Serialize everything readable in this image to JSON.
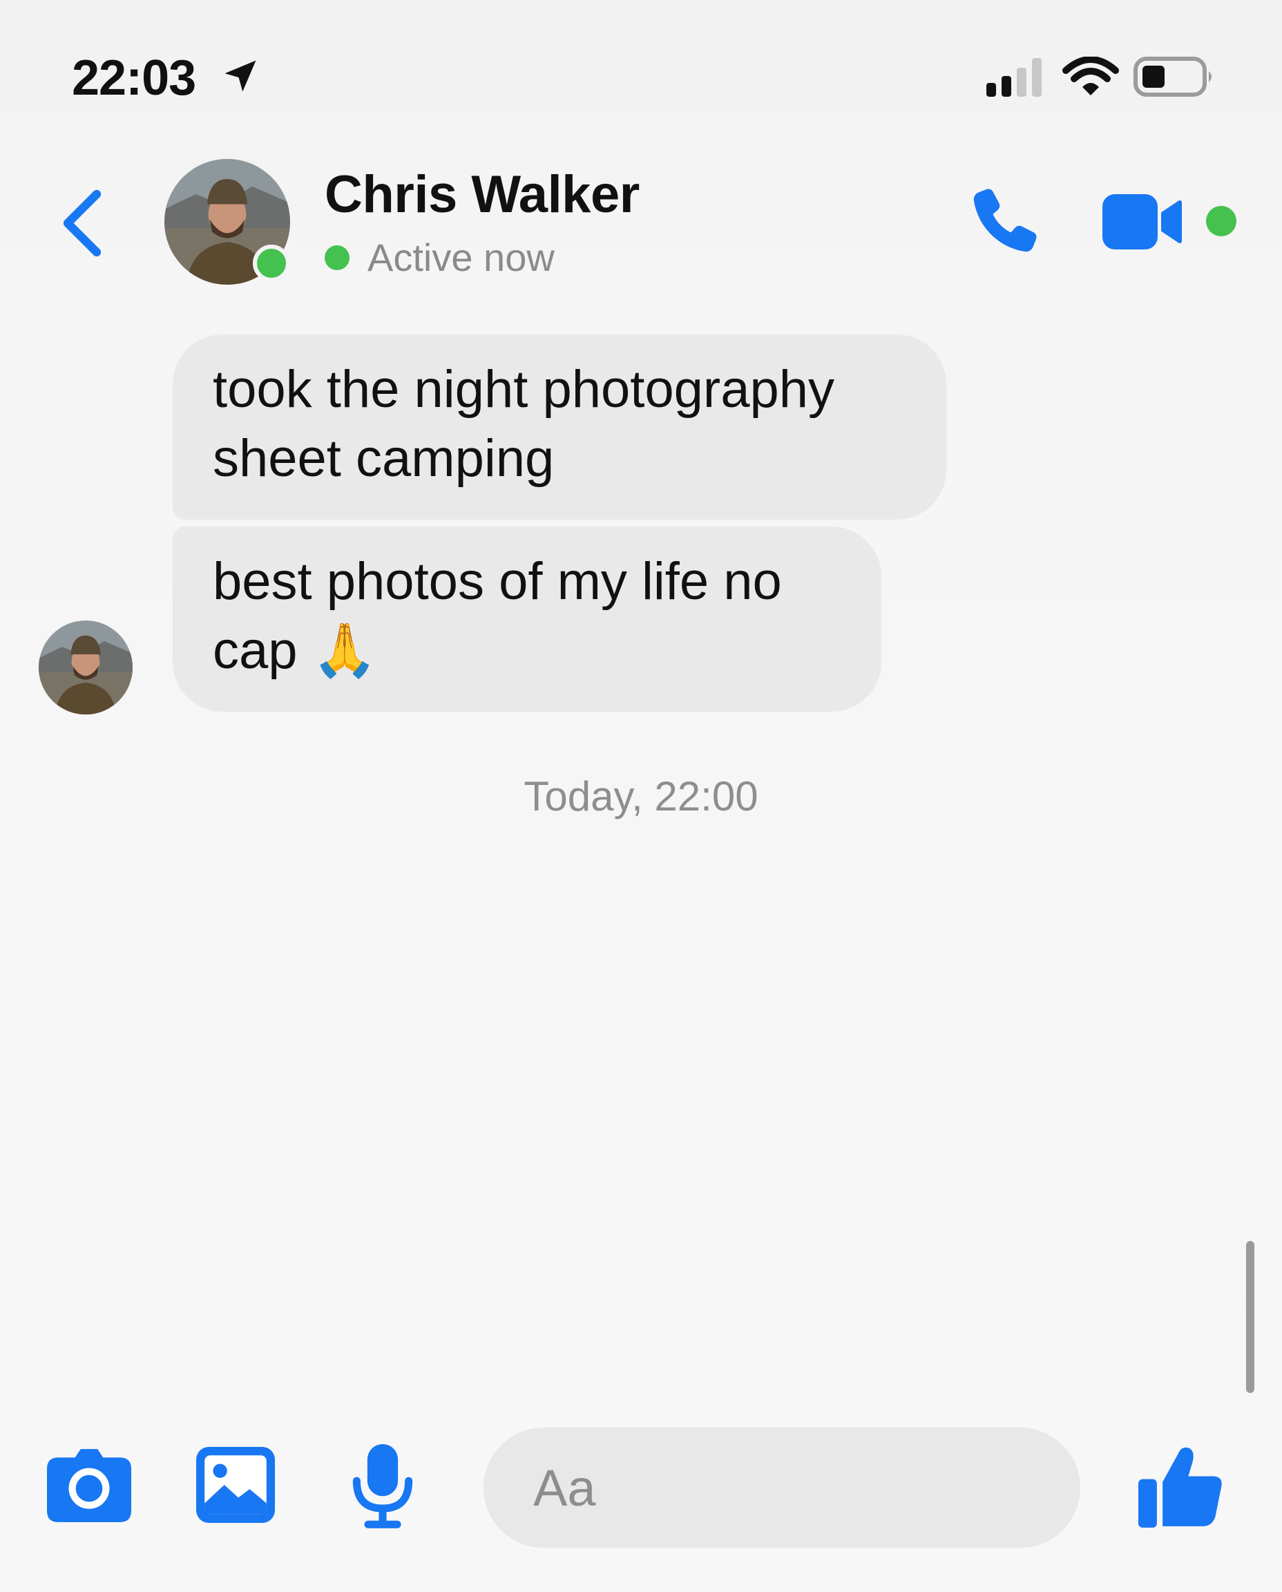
{
  "status_bar": {
    "time": "22:03",
    "icons": [
      "location-arrow-icon",
      "cellular-signal-icon",
      "wifi-icon",
      "battery-icon"
    ]
  },
  "header": {
    "contact_name": "Chris Walker",
    "status": "Active now",
    "icons": [
      "back-chevron-icon",
      "phone-icon",
      "video-camera-icon"
    ]
  },
  "messages": [
    {
      "lines": [
        "took the night photography",
        "sheet camping"
      ]
    },
    {
      "lines": [
        "best photos of my life no",
        "cap 🙏"
      ]
    }
  ],
  "timestamp": "Today, 22:00",
  "composer": {
    "placeholder": "Aa",
    "icons": [
      "camera-icon",
      "image-icon",
      "microphone-icon",
      "thumbs-up-icon"
    ]
  },
  "colors": {
    "accent": "#1877f2",
    "online": "#45c150",
    "bubble": "#e9e9ea",
    "muted_text": "#8a8a8a"
  }
}
